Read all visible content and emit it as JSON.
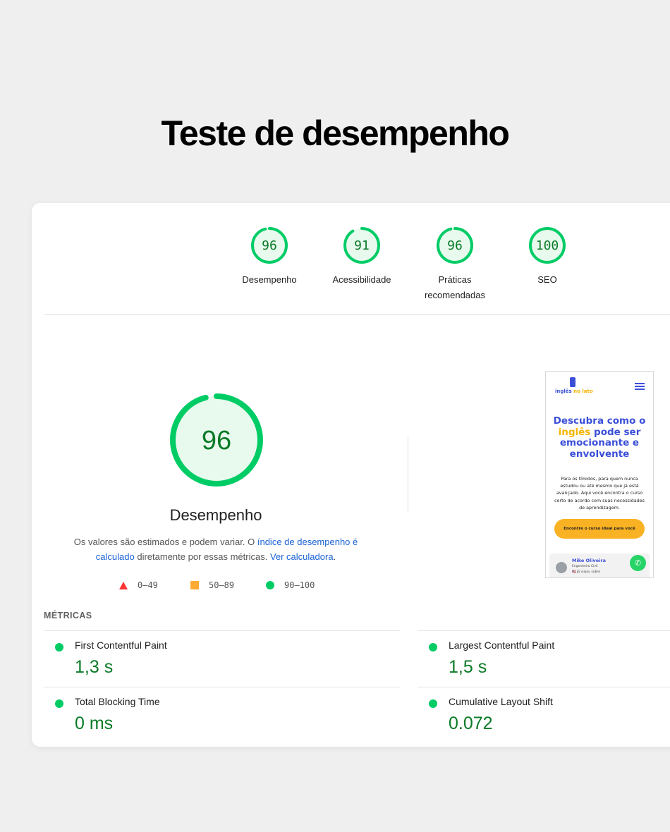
{
  "page_title": "Teste de desempenho",
  "colors": {
    "pass_green": "#0c6",
    "score_text": "#0a7a26",
    "average_orange": "#fa3",
    "fail_red": "#f33",
    "link_blue": "#1a62d6"
  },
  "categories": [
    {
      "score": 96,
      "label": "Desempenho"
    },
    {
      "score": 91,
      "label": "Acessibilidade"
    },
    {
      "score": 96,
      "label": "Práticas recomendadas"
    },
    {
      "score": 100,
      "label": "SEO"
    }
  ],
  "performance": {
    "score": 96,
    "label": "Desempenho",
    "desc_part1": "Os valores são estimados e podem variar. O ",
    "desc_link1": "índice de desempenho é calculado",
    "desc_part2": " diretamente por essas métricas. ",
    "desc_link2": "Ver calculadora",
    "desc_part3": "."
  },
  "legend": {
    "fail": "0–49",
    "average": "50–89",
    "pass": "90–100"
  },
  "preview": {
    "logo_part1": "inglês ",
    "logo_part2": "no lato",
    "headline_part1": "Descubra como o ",
    "headline_highlight": "inglês",
    "headline_part2": " pode ser emocionante e envolvente",
    "subtext": "Para os tímidos, para quem nunca estudou ou até mesmo que já está avançado. Aqui você encontra o curso certo de acordo com suas necessidades de aprendizagem.",
    "cta": "Encontre o curso ideal para você",
    "person_name": "Mike Oliveira",
    "person_role": "Engenheiro Civil",
    "person_extra": "🇺🇸 Já viajou sobre"
  },
  "metrics": {
    "title": "MÉTRICAS",
    "items": [
      {
        "name": "First Contentful Paint",
        "value": "1,3 s"
      },
      {
        "name": "Largest Contentful Paint",
        "value": "1,5 s"
      },
      {
        "name": "Total Blocking Time",
        "value": "0 ms"
      },
      {
        "name": "Cumulative Layout Shift",
        "value": "0.072"
      }
    ]
  }
}
